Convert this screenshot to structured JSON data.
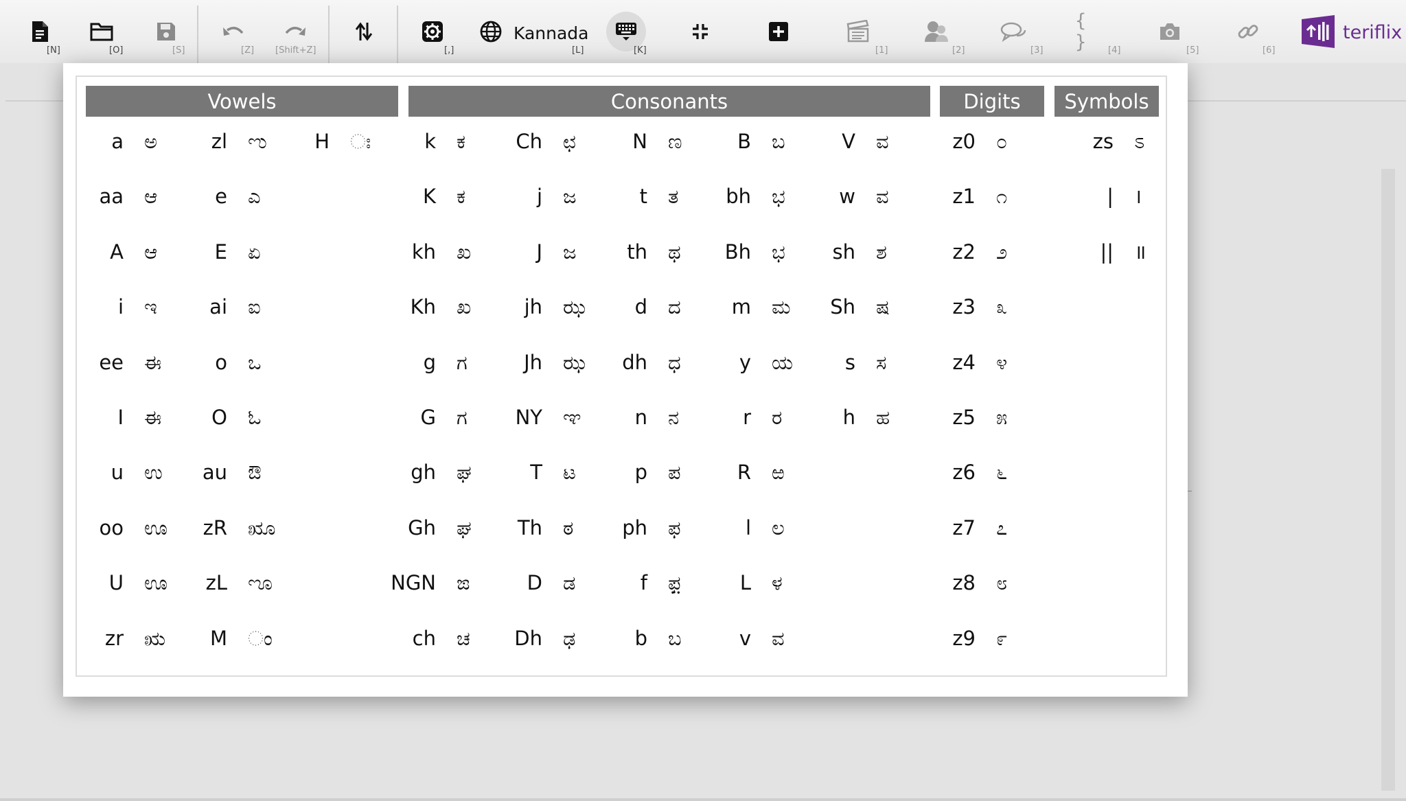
{
  "toolbar": {
    "new_shortcut": "[N]",
    "open_shortcut": "[O]",
    "save_shortcut": "[S]",
    "undo_shortcut": "[Z]",
    "redo_shortcut": "[Shift+Z]",
    "settings_shortcut": "[,]",
    "language_label": "Kannada",
    "language_shortcut": "[L]",
    "keyboard_shortcut": "[K]",
    "f1": "[1]",
    "f2": "[2]",
    "f3": "[3]",
    "braces_label": "{ }",
    "f4": "[4]",
    "f5": "[5]",
    "f6": "[6]",
    "brand": "teriflix"
  },
  "colors": {
    "brand": "#6b2c91",
    "header_bg": "#777777",
    "active_bg": "#dcdcdc"
  },
  "vowels_header": "Vowels",
  "consonants_header": "Consonants",
  "digits_header": "Digits",
  "symbols_header": "Symbols",
  "vowels": [
    [
      [
        "a",
        "ಅ"
      ],
      [
        "aa",
        "ಆ"
      ],
      [
        "A",
        "ಆ"
      ],
      [
        "i",
        "ಇ"
      ],
      [
        "ee",
        "ಈ"
      ],
      [
        "I",
        "ಈ"
      ],
      [
        "u",
        "ಉ"
      ],
      [
        "oo",
        "ಊ"
      ],
      [
        "U",
        "ಊ"
      ],
      [
        "zr",
        "ಋ"
      ]
    ],
    [
      [
        "zl",
        "ಌ"
      ],
      [
        "e",
        "ಎ"
      ],
      [
        "E",
        "ಏ"
      ],
      [
        "ai",
        "ಐ"
      ],
      [
        "o",
        "ಒ"
      ],
      [
        "O",
        "ಓ"
      ],
      [
        "au",
        "ಔ"
      ],
      [
        "zR",
        "ೠ"
      ],
      [
        "zL",
        "ೡ"
      ],
      [
        "M",
        "ಂ"
      ]
    ],
    [
      [
        "H",
        "ಃ"
      ]
    ]
  ],
  "consonants": [
    [
      [
        "k",
        "ಕ"
      ],
      [
        "K",
        "ಕ"
      ],
      [
        "kh",
        "ಖ"
      ],
      [
        "Kh",
        "ಖ"
      ],
      [
        "g",
        "ಗ"
      ],
      [
        "G",
        "ಗ"
      ],
      [
        "gh",
        "ಘ"
      ],
      [
        "Gh",
        "ಘ"
      ],
      [
        "NGN",
        "ಙ"
      ],
      [
        "ch",
        "ಚ"
      ]
    ],
    [
      [
        "Ch",
        "ಛ"
      ],
      [
        "j",
        "ಜ"
      ],
      [
        "J",
        "ಜ"
      ],
      [
        "jh",
        "ಝ"
      ],
      [
        "Jh",
        "ಝ"
      ],
      [
        "NY",
        "ಞ"
      ],
      [
        "T",
        "ಟ"
      ],
      [
        "Th",
        "ಠ"
      ],
      [
        "D",
        "ಡ"
      ],
      [
        "Dh",
        "ಢ"
      ]
    ],
    [
      [
        "N",
        "ಣ"
      ],
      [
        "t",
        "ತ"
      ],
      [
        "th",
        "ಥ"
      ],
      [
        "d",
        "ದ"
      ],
      [
        "dh",
        "ಧ"
      ],
      [
        "n",
        "ನ"
      ],
      [
        "p",
        "ಪ"
      ],
      [
        "ph",
        "ಫ"
      ],
      [
        "f",
        "ಫ಼"
      ],
      [
        "b",
        "ಬ"
      ]
    ],
    [
      [
        "B",
        "ಬ"
      ],
      [
        "bh",
        "ಭ"
      ],
      [
        "Bh",
        "ಭ"
      ],
      [
        "m",
        "ಮ"
      ],
      [
        "y",
        "ಯ"
      ],
      [
        "r",
        "ರ"
      ],
      [
        "R",
        "ಱ"
      ],
      [
        "l",
        "ಲ"
      ],
      [
        "L",
        "ಳ"
      ],
      [
        "v",
        "ವ"
      ]
    ],
    [
      [
        "V",
        "ವ"
      ],
      [
        "w",
        "ವ"
      ],
      [
        "sh",
        "ಶ"
      ],
      [
        "Sh",
        "ಷ"
      ],
      [
        "s",
        "ಸ"
      ],
      [
        "h",
        "ಹ"
      ]
    ]
  ],
  "digits": [
    [
      [
        "z0",
        "೦"
      ],
      [
        "z1",
        "೧"
      ],
      [
        "z2",
        "೨"
      ],
      [
        "z3",
        "೩"
      ],
      [
        "z4",
        "೪"
      ],
      [
        "z5",
        "೫"
      ],
      [
        "z6",
        "೬"
      ],
      [
        "z7",
        "೭"
      ],
      [
        "z8",
        "೮"
      ],
      [
        "z9",
        "೯"
      ]
    ]
  ],
  "symbols": [
    [
      [
        "zs",
        "ಽ"
      ],
      [
        "|",
        "।"
      ],
      [
        "||",
        "॥"
      ]
    ]
  ]
}
